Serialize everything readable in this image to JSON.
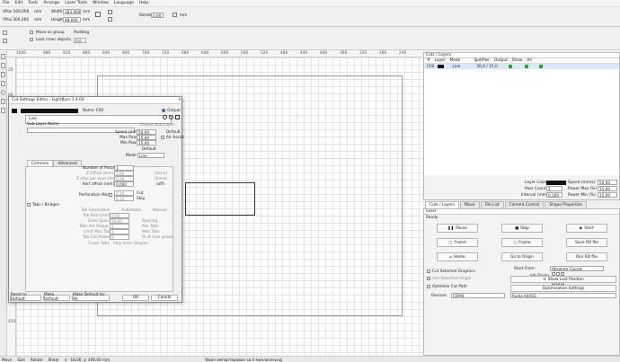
{
  "menu": [
    "File",
    "Edit",
    "Tools",
    "Arrange",
    "Laser Tools",
    "Window",
    "Language",
    "Help"
  ],
  "toolbar": {
    "xpos": "XPos 500,000",
    "ypos": "YPos 300,000",
    "x_unit": "mm",
    "width_label": "Width",
    "width_value": "383,900",
    "height_label": "Height",
    "height_value": "98,000",
    "rotate_label": "Rotate",
    "rotate_value": "0,00",
    "mm": "mm",
    "move_as_group": "Move as group",
    "lock_inner": "Lock inner objects",
    "padding_label": "Padding",
    "padding_value": "0,0"
  },
  "ruler_top": [
    "1040",
    "980",
    "920",
    "880",
    "840",
    "800",
    "760",
    "720",
    "680",
    "640",
    "600",
    "560",
    "520",
    "480",
    "440",
    "400",
    "360",
    "320",
    "280",
    "240",
    "200",
    "160",
    "120",
    "80",
    "40"
  ],
  "ruler_left": [
    "20",
    "60",
    "100",
    "140",
    "180",
    "220",
    "260",
    "300",
    "340",
    "380",
    "420"
  ],
  "dialog": {
    "title": "Cut Settings Editor - LightBurn 1.4.00",
    "name_label": "Name",
    "name_value": "C00",
    "output_label": "Output",
    "line_label": "Line",
    "sublayer_label": "Sub-Layer Name",
    "output_sublayer": "Output Sub-Layer",
    "speed_label": "Speed (mm/sec)",
    "speed_value": "50,00",
    "default_label": "Default",
    "max_power_label": "Max Power (%)",
    "max_power_value": "15,00",
    "air_assist": "Air Assist",
    "min_power_label": "Min Power (%)",
    "min_power_value": "15,00",
    "default2": "Default",
    "mode_label": "Mode",
    "mode_value": "Line",
    "tab_common": "Common",
    "tab_advanced": "Advanced",
    "passes_label": "Number of Passes",
    "passes_value": "1",
    "zoffset_label": "Z Offset (mm)",
    "zoffset_value": "0,00",
    "zoffset_note": "(none)",
    "zstep_label": "Z step per pass (mm)",
    "zstep_value": "0,00",
    "zstep_note": "(none)",
    "kerf_label": "Kerf offset (mm)",
    "kerf_value": "0,000",
    "kerf_note": "(off)",
    "perf_label": "Perforation Mode",
    "perf_cut_value": "0,10",
    "perf_cut": "Cut",
    "perf_skip_value": "0,10",
    "perf_skip": "Skip",
    "tabs_label": "Tabs / Bridges",
    "tab_gen": "Tab Generation",
    "automatic": "Automatic",
    "manual": "Manual",
    "tab_size_label": "Tab Size (mm)",
    "tab_size_value": "0,50",
    "even_spacing_label": "Even Spacing",
    "even_spacing_value": "50,00",
    "spacing": "Spacing",
    "tabs_per_shape_label": "Tabs Per Shape",
    "tabs_per_shape_value": "1",
    "min_tabs": "Min Tabs",
    "limit_max_label": "Limit Max Tabs",
    "limit_max_value": "1",
    "max_tabs": "Max Tabs",
    "tab_cut_power_label": "Tab Cut Power",
    "tab_cut_power_value": "0",
    "pct_max": "% of max power",
    "cover_tabs": "Cover Tabs",
    "skip_inner": "Skip Inner Shapes",
    "reset_btn": "Reset to Default",
    "make_default_btn": "Make Default",
    "make_default_all_btn": "Make Default for All",
    "ok_btn": "OK",
    "cancel_btn": "Cancel"
  },
  "cuts": {
    "title": "Cuts / Layers",
    "headers": [
      "#",
      "Layer",
      "Mode",
      "Spd/Pwr",
      "Output",
      "Show",
      "Air"
    ],
    "row": {
      "num": "C00",
      "mode": "Line",
      "spdpwr": "50,0 / 15,0"
    },
    "layer_color_label": "Layer Color",
    "speed_label": "Speed (mm/s)",
    "speed_value": "50,00",
    "pass_count_label": "Pass Count",
    "pass_count_value": "1",
    "power_max_label": "Power Max (%)",
    "power_max_value": "15,00",
    "interval_label": "Interval (mm)",
    "interval_value": "0,100",
    "power_min_label": "Power Min (%)",
    "power_min_value": "15,00"
  },
  "right_tabs": [
    "Cuts / Layers",
    "Move",
    "File List",
    "Camera Control",
    "Shape Properties"
  ],
  "laser": {
    "title": "Laser",
    "status": "Ready",
    "pause": "Pause",
    "stop": "Stop",
    "start": "Start",
    "frame1": "Frame",
    "frame2": "Frame",
    "save_rd": "Save RD file",
    "run_rd": "Run RD file",
    "home": "Home",
    "go_origin": "Go to Origin",
    "start_from_label": "Start From:",
    "start_from_value": "Absolute Coords",
    "job_origin_label": "Job Origin",
    "cut_selected": "Cut Selected Graphics",
    "use_selection_origin": "Use Selection Origin",
    "show_last_position": "Show Last Position",
    "optimize_cut": "Optimize Cut Path",
    "optimization_settings": "Optimization Settings",
    "devices_label": "Devices",
    "port_value": "COM4",
    "device_value": "Ruida 6445G"
  },
  "statusbar": {
    "move": "Move",
    "size": "Size",
    "rotate": "Rotate",
    "shear": "Shear",
    "coords": "x: -18,00, y: 406,00 mm",
    "message": "Файл импортирован за 0 миллисекунд"
  },
  "colors": {
    "accent": "#1e6fd0",
    "layer_black": "#111111"
  }
}
